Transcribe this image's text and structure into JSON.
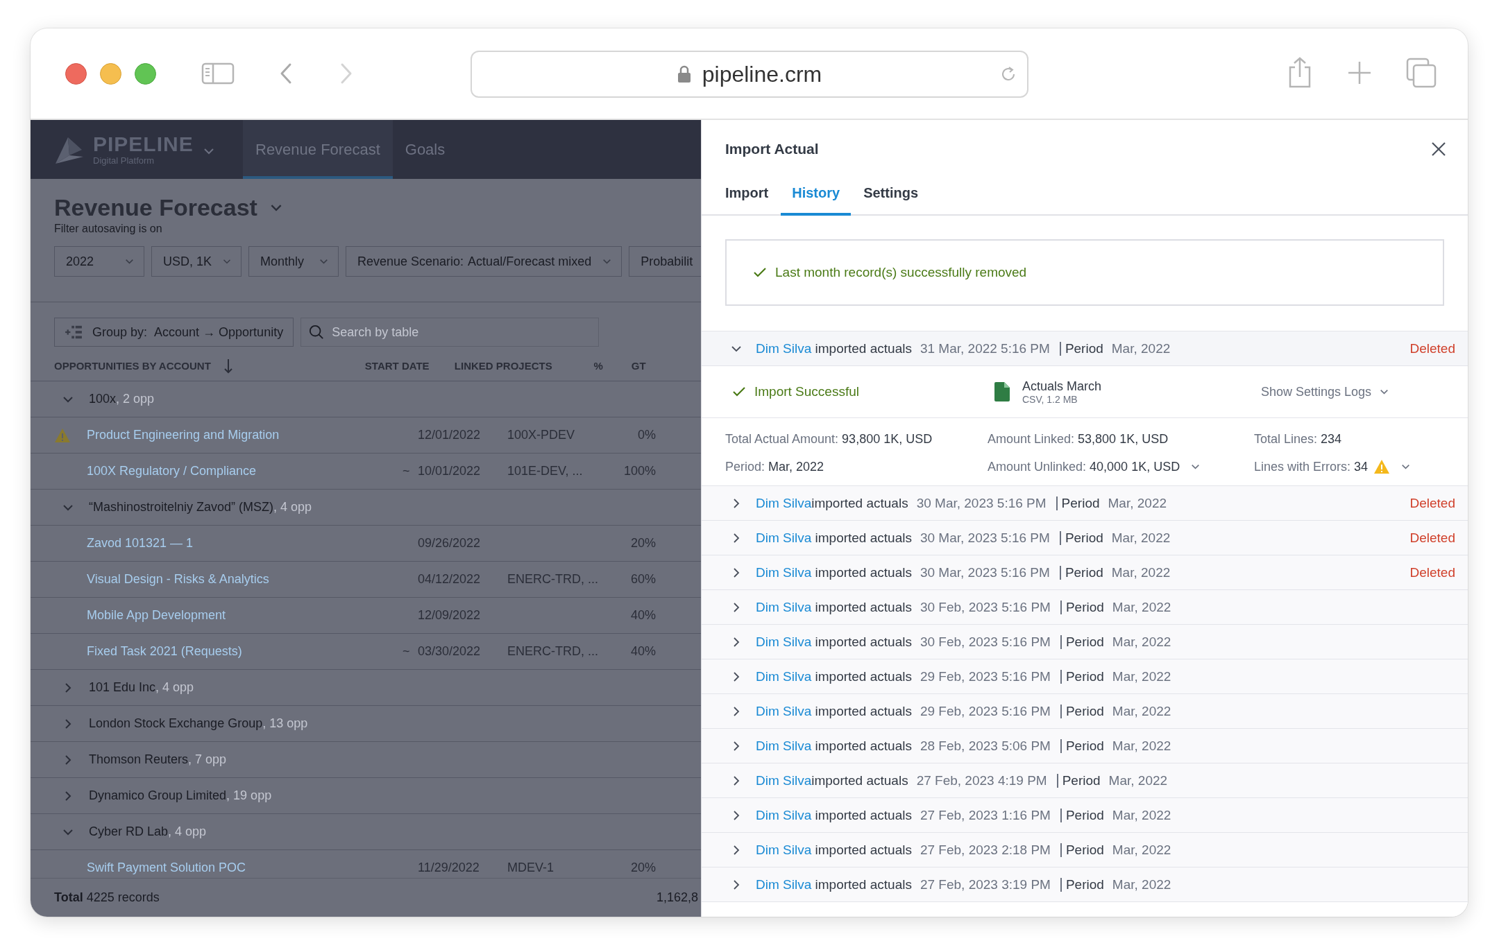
{
  "browser": {
    "url": "pipeline.crm"
  },
  "app": {
    "brand": "PIPELINE",
    "brand_subtitle": "Digital Platform",
    "nav": [
      {
        "label": "Revenue Forecast",
        "selected": true
      },
      {
        "label": "Goals",
        "selected": false
      }
    ],
    "title": "Revenue Forecast",
    "subtitle": "Filter autosaving is on",
    "filters": [
      {
        "value": "2022"
      },
      {
        "value": "USD, 1K"
      },
      {
        "value": "Monthly"
      },
      {
        "label": "Revenue Scenario:",
        "value": "Actual/Forecast mixed"
      },
      {
        "label": "Probabilit"
      }
    ],
    "group_by": {
      "label": "Group by:",
      "value": "Account → Opportunity"
    },
    "search": {
      "placeholder": "Search by table"
    },
    "table": {
      "columns": [
        "OPPORTUNITIES BY ACCOUNT",
        "START DATE",
        "LINKED PROJECTS",
        "%",
        "GT"
      ],
      "groups": [
        {
          "name": "100x",
          "count": ", 2 opp",
          "expanded": true,
          "children": [
            {
              "name": "Product Engineering and Migration",
              "warning": true,
              "start_date": "12/01/2022",
              "linked": "100X-PDEV",
              "percent": "0%"
            },
            {
              "name": "100X Regulatory / Compliance",
              "warning": false,
              "marker": "~",
              "start_date": "10/01/2022",
              "linked": "101E-DEV, ...",
              "percent": "100%"
            }
          ]
        },
        {
          "name": "“Mashinostroitelniy Zavod” (MSZ)",
          "count": ", 4 opp",
          "expanded": true,
          "children": [
            {
              "name": "Zavod 101321 — 1",
              "warning": false,
              "start_date": "09/26/2022",
              "percent": "20%"
            },
            {
              "name": "Visual Design - Risks & Analytics",
              "warning": false,
              "start_date": "04/12/2022",
              "linked": "ENERC-TRD, ...",
              "percent": "60%"
            },
            {
              "name": "Mobile App Development",
              "warning": false,
              "start_date": "12/09/2022",
              "percent": "40%"
            },
            {
              "name": "Fixed Task  2021 (Requests)",
              "warning": false,
              "marker": "~",
              "start_date": "03/30/2022",
              "linked": "ENERC-TRD, ...",
              "percent": "40%"
            }
          ]
        },
        {
          "name": "101 Edu Inc",
          "count": ", 4 opp",
          "expanded": false
        },
        {
          "name": "London Stock Exchange Group",
          "count": ", 13 opp",
          "expanded": false
        },
        {
          "name": "Thomson Reuters",
          "count": ", 7 opp",
          "expanded": false
        },
        {
          "name": "Dynamico Group Limited",
          "count": ", 19 opp",
          "expanded": false
        },
        {
          "name": "Cyber RD Lab",
          "count": ", 4 opp",
          "expanded": true,
          "children": [
            {
              "name": "Swift Payment Solution POC",
              "warning": false,
              "start_date": "11/29/2022",
              "linked": "MDEV-1",
              "percent": "20%"
            }
          ]
        }
      ],
      "footer": {
        "label": "Total",
        "records": "4225 records",
        "sum": "1,162,8"
      }
    }
  },
  "panel": {
    "title": "Import Actual",
    "tabs": [
      {
        "label": "Import",
        "selected": false
      },
      {
        "label": "History",
        "selected": true
      },
      {
        "label": "Settings",
        "selected": false
      }
    ],
    "message": "Last month record(s) successfully removed",
    "history": [
      {
        "user": "Dim Silva",
        "action": " imported actuals",
        "date": "31 Mar, 2022 5:16 PM",
        "period_label": "Period",
        "period": "Mar, 2022",
        "status": "Deleted",
        "expanded": true,
        "details": {
          "result": "Import Successful",
          "file_name": "Actuals March",
          "file_meta": "CSV, 1.2 MB",
          "logs_link": "Show Settings Logs",
          "stats": [
            {
              "label": "Total Actual Amount:",
              "value": "93,800 1K, USD",
              "warning": false,
              "dropdown": false
            },
            {
              "label": "Amount Linked:",
              "value": "53,800 1K, USD",
              "warning": false,
              "dropdown": false
            },
            {
              "label": "Total Lines:",
              "value": "234",
              "warning": false,
              "dropdown": false
            },
            {
              "label": "Period:",
              "value": "Mar, 2022",
              "warning": false,
              "dropdown": false
            },
            {
              "label": "Amount Unlinked:",
              "value": "40,000 1K, USD",
              "warning": false,
              "dropdown": true
            },
            {
              "label": "Lines with Errors:",
              "value": "34",
              "warning": true,
              "dropdown": true
            }
          ]
        }
      },
      {
        "user": "Dim Silva",
        "action": "imported actuals",
        "date": "30 Mar, 2023 5:16 PM",
        "period_label": "Period",
        "period": "Mar, 2022",
        "status": "Deleted",
        "expanded": false
      },
      {
        "user": "Dim Silva",
        "action": " imported actuals",
        "date": "30 Mar, 2023 5:16 PM",
        "period_label": "Period",
        "period": "Mar, 2022",
        "status": "Deleted",
        "expanded": false
      },
      {
        "user": "Dim Silva",
        "action": " imported actuals",
        "date": "30 Mar, 2023 5:16 PM",
        "period_label": "Period",
        "period": "Mar, 2022",
        "status": "Deleted",
        "expanded": false
      },
      {
        "user": "Dim Silva",
        "action": " imported actuals",
        "date": "30 Feb, 2023 5:16 PM",
        "period_label": "Period",
        "period": "Mar, 2022",
        "expanded": false
      },
      {
        "user": "Dim Silva",
        "action": " imported actuals",
        "date": "30 Feb, 2023 5:16 PM",
        "period_label": "Period",
        "period": "Mar, 2022",
        "expanded": false
      },
      {
        "user": "Dim Silva",
        "action": " imported actuals",
        "date": "29 Feb, 2023 5:16 PM",
        "period_label": "Period",
        "period": "Mar, 2022",
        "expanded": false
      },
      {
        "user": "Dim Silva",
        "action": " imported actuals",
        "date": "29 Feb, 2023 5:16 PM",
        "period_label": "Period",
        "period": "Mar, 2022",
        "expanded": false
      },
      {
        "user": "Dim Silva",
        "action": " imported actuals",
        "date": "28 Feb, 2023 5:06 PM",
        "period_label": "Period",
        "period": "Mar, 2022",
        "expanded": false
      },
      {
        "user": "Dim Silva",
        "action": "imported actuals",
        "date": "27 Feb, 2023 4:19 PM",
        "period_label": "Period",
        "period": "Mar, 2022",
        "expanded": false
      },
      {
        "user": "Dim Silva",
        "action": " imported actuals",
        "date": "27 Feb, 2023 1:16 PM",
        "period_label": "Period",
        "period": "Mar, 2022",
        "expanded": false
      },
      {
        "user": "Dim Silva",
        "action": " imported actuals",
        "date": "27 Feb, 2023 2:18 PM",
        "period_label": "Period",
        "period": "Mar, 2022",
        "expanded": false
      },
      {
        "user": "Dim Silva",
        "action": " imported actuals",
        "date": "27 Feb, 2023 3:19 PM",
        "period_label": "Period",
        "period": "Mar, 2022",
        "expanded": false
      }
    ]
  }
}
